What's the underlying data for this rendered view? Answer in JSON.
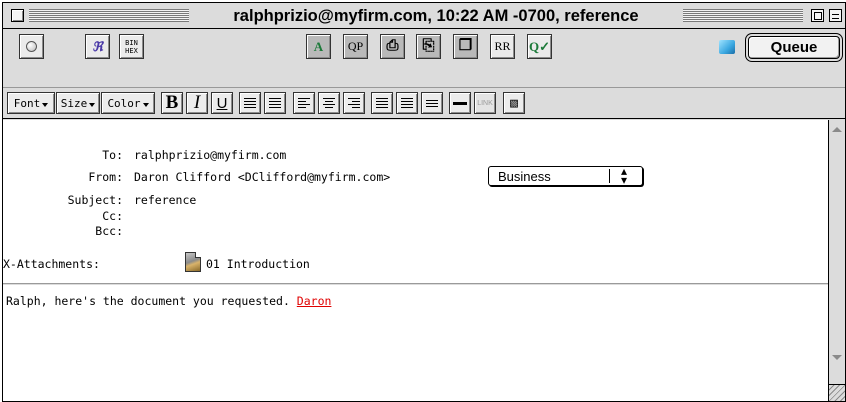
{
  "window": {
    "title": "ralphprizio@myfirm.com, 10:22 AM -0700, reference"
  },
  "toolbar": {
    "binhex_label_top": "BIN",
    "binhex_label_bottom": "HEX",
    "qp_label": "QP",
    "rr_label": "RR",
    "queue_label": "Queue"
  },
  "format_bar": {
    "font_label": "Font",
    "size_label": "Size",
    "color_label": "Color",
    "bold_label": "B",
    "italic_label": "I",
    "underline_label": "U",
    "link_label": "LINK"
  },
  "headers": {
    "to_label": "To:",
    "to_value": "ralphprizio@myfirm.com",
    "from_label": "From:",
    "from_value": "Daron Clifford <DClifford@myfirm.com>",
    "personality": "Business",
    "subject_label": "Subject:",
    "subject_value": "reference",
    "cc_label": "Cc:",
    "cc_value": "",
    "bcc_label": "Bcc:",
    "bcc_value": "",
    "attachments_label": "X-Attachments:",
    "attachment_name": "01 Introduction"
  },
  "body": {
    "text": "Ralph, here's the document you requested. ",
    "signature": "Daron"
  },
  "colors": {
    "signature_link": "#e00000",
    "window_chrome": "#dcdcdc"
  }
}
